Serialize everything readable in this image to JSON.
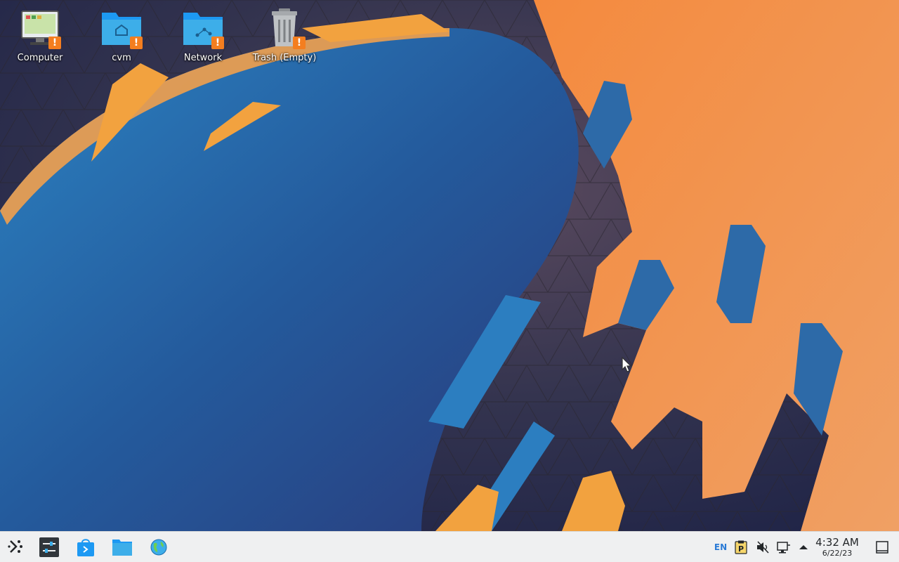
{
  "desktop": {
    "icons": [
      {
        "label": "Computer",
        "icon": "computer-icon"
      },
      {
        "label": "cvm",
        "icon": "home-folder-icon"
      },
      {
        "label": "Network",
        "icon": "network-folder-icon"
      },
      {
        "label": "Trash (Empty)",
        "icon": "trash-icon"
      }
    ],
    "badge_glyph": "!"
  },
  "taskbar": {
    "launcher_icon": "application-launcher-icon",
    "tasks": [
      {
        "name": "system-settings-icon"
      },
      {
        "name": "discover-store-icon"
      },
      {
        "name": "file-manager-icon"
      },
      {
        "name": "web-browser-icon"
      }
    ],
    "tray": {
      "language": "EN",
      "clipboard_icon": "klipper-clipboard-icon",
      "volume_icon": "volume-muted-icon",
      "network_icon": "network-wired-icon",
      "expand_icon": "tray-expand-arrow-icon"
    },
    "clock": {
      "time": "4:32 AM",
      "date": "6/22/23"
    },
    "show_desktop_icon": "show-desktop-icon"
  },
  "colors": {
    "accent": "#3daee9",
    "warning": "#f47e1f",
    "panel": "#eff0f1",
    "wallpaper_orange": "#f28e4a",
    "wallpaper_blue": "#2a6ca9"
  }
}
